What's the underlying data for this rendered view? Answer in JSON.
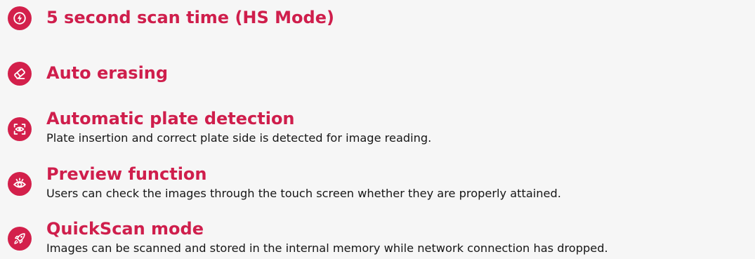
{
  "features": [
    {
      "icon": "lightning-icon",
      "title": "5 second scan time (HS Mode)",
      "description": ""
    },
    {
      "icon": "eraser-icon",
      "title": "Auto erasing",
      "description": ""
    },
    {
      "icon": "eye-scan-icon",
      "title": "Automatic plate detection",
      "description": "Plate insertion and correct plate side is detected for image reading."
    },
    {
      "icon": "eye-icon",
      "title": "Preview function",
      "description": "Users can check the images through the touch screen whether they are properly attained."
    },
    {
      "icon": "rocket-icon",
      "title": "QuickScan mode",
      "description": "Images can be scanned and stored in the internal memory while network connection has dropped."
    }
  ],
  "colors": {
    "accent": "#d3204b",
    "title": "#cf1e4c",
    "text": "#161616",
    "background": "#f6f6f6"
  }
}
